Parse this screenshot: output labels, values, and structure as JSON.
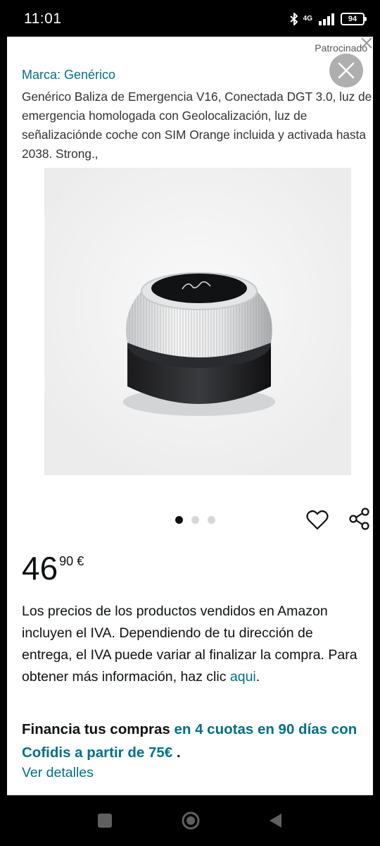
{
  "status_bar": {
    "time": "11:01",
    "network": "4G",
    "battery": "94",
    "icons": [
      "bluetooth-icon",
      "signal-icon",
      "battery-icon"
    ]
  },
  "ad": {
    "sponsored_label": "Patrocinado",
    "close_icon": "close-icon"
  },
  "product": {
    "brand": "Marca: Genérico",
    "title": "Genérico Baliza de Emergencia V16, Conectada DGT 3.0, luz de emergencia homologada con Geolocalización, luz de señalizaciónde coche con SIM Orange incluida y activada hasta 2038. Strong.,",
    "image_count": 3,
    "active_image": 1
  },
  "price": {
    "whole": "46",
    "fraction": "90 €"
  },
  "iva_notice": {
    "text": "Los precios de los productos vendidos en Amazon incluyen el IVA. Dependiendo de tu dirección de entrega, el IVA puede variar al finalizar la compra. Para obtener más información, haz clic ",
    "link": "aqui",
    "end": "."
  },
  "financing": {
    "prefix": "Financia tus compras ",
    "link": "en 4 cuotas en 90 días con Cofidis a partir de 75€",
    "suffix": " ."
  },
  "details_link": "Ver detalles",
  "colors": {
    "link": "#007185",
    "text": "#0f1111",
    "background": "#ffffff"
  },
  "nav": [
    "recents-button",
    "home-button",
    "back-button"
  ]
}
